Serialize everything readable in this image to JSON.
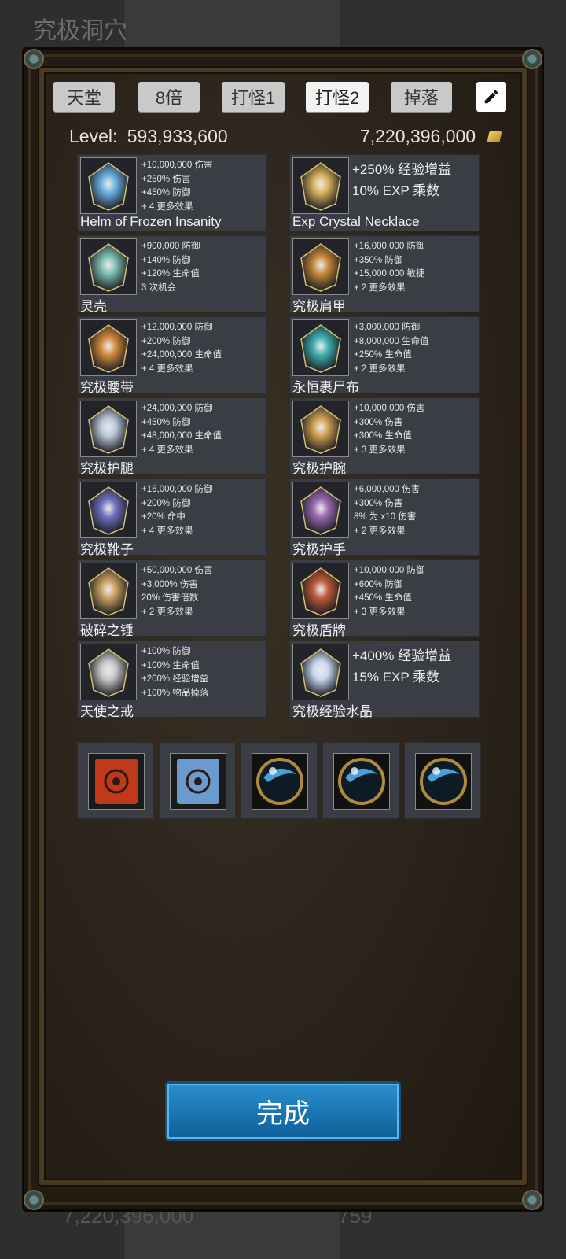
{
  "background": {
    "title": "究极洞穴",
    "bottom_left_text": "7,220,396,000",
    "bottom_right_text": "759"
  },
  "tabs": [
    {
      "label": "天堂",
      "active": false
    },
    {
      "label": "8倍",
      "active": false
    },
    {
      "label": "打怪1",
      "active": false
    },
    {
      "label": "打怪2",
      "active": true
    },
    {
      "label": "掉落",
      "active": false
    }
  ],
  "edit_icon": "pencil-icon",
  "header": {
    "level_label": "Level:",
    "level_value": "593,933,600",
    "gold_value": "7,220,396,000",
    "gold_icon": "gold-coin-icon"
  },
  "equipment": [
    {
      "name": "Helm of Frozen Insanity",
      "icon": "helm-icon",
      "color": "#6ab0e0",
      "stats": [
        "+10,000,000 伤害",
        "+250% 伤害",
        "+450% 防御",
        "+ 4 更多效果"
      ]
    },
    {
      "name": "Exp Crystal Necklace",
      "icon": "necklace-icon",
      "color": "#d9b45a",
      "big_stats": [
        "+250% 经验增益",
        "10% EXP 乘数"
      ]
    },
    {
      "name": "灵壳",
      "icon": "armor-icon",
      "color": "#7bbfb0",
      "stats": [
        "+900,000 防御",
        "+140% 防御",
        "+120% 生命值",
        "3 次机会"
      ]
    },
    {
      "name": "究极肩甲",
      "icon": "pauldron-icon",
      "color": "#c88a3a",
      "stats": [
        "+16,000,000 防御",
        "+350% 防御",
        "+15,000,000 敏捷",
        "+ 2 更多效果"
      ]
    },
    {
      "name": "究极腰带",
      "icon": "belt-icon",
      "color": "#d28a3a",
      "stats": [
        "+12,000,000 防御",
        "+200% 防御",
        "+24,000,000 生命值",
        "+ 4 更多效果"
      ]
    },
    {
      "name": "永恒裹尸布",
      "icon": "cloak-icon",
      "color": "#3fb0b0",
      "stats": [
        "+3,000,000 防御",
        "+8,000,000 生命值",
        "+250% 生命值",
        "+ 2 更多效果"
      ]
    },
    {
      "name": "究极护腿",
      "icon": "leggings-icon",
      "color": "#b8c8d8",
      "stats": [
        "+24,000,000 防御",
        "+450% 防御",
        "+48,000,000 生命值",
        "+ 4 更多效果"
      ]
    },
    {
      "name": "究极护腕",
      "icon": "bracer-icon",
      "color": "#d0a050",
      "stats": [
        "+10,000,000 伤害",
        "+300% 伤害",
        "+300% 生命值",
        "+ 3 更多效果"
      ]
    },
    {
      "name": "究极靴子",
      "icon": "boots-icon",
      "color": "#7070c0",
      "stats": [
        "+16,000,000 防御",
        "+200% 防御",
        "+20% 命中",
        "+ 4 更多效果"
      ]
    },
    {
      "name": "究极护手",
      "icon": "gauntlets-icon",
      "color": "#9a6ab0",
      "stats": [
        "+6,000,000 伤害",
        "+300% 伤害",
        "8% 为 x10 伤害",
        "+ 2 更多效果"
      ]
    },
    {
      "name": "破碎之锤",
      "icon": "hammer-icon",
      "color": "#c8a060",
      "stats": [
        "+50,000,000 伤害",
        "+3,000% 伤害",
        "20% 伤害倍数",
        "+ 2 更多效果"
      ]
    },
    {
      "name": "究极盾牌",
      "icon": "shield-icon",
      "color": "#c05a3a",
      "stats": [
        "+10,000,000 防御",
        "+600% 防御",
        "+450% 生命值",
        "+ 3 更多效果"
      ]
    },
    {
      "name": "天使之戒",
      "icon": "ring-icon",
      "color": "#c8c8c8",
      "stats": [
        "+100% 防御",
        "+100% 生命值",
        "+200% 经验增益",
        "+100% 物品掉落"
      ]
    },
    {
      "name": "究极经验水晶",
      "icon": "crystal-icon",
      "color": "#c8d8f0",
      "big_stats": [
        "+400% 经验增益",
        "15% EXP 乘数"
      ]
    }
  ],
  "consumables": [
    {
      "icon": "red-tome-icon",
      "color": "#c03a1a"
    },
    {
      "icon": "blue-tome-icon",
      "color": "#6a9ad0"
    },
    {
      "icon": "orb-icon",
      "color": "#4aa0d8"
    },
    {
      "icon": "orb-icon",
      "color": "#4aa0d8"
    },
    {
      "icon": "orb-icon",
      "color": "#4aa0d8"
    }
  ],
  "done_button": "完成"
}
